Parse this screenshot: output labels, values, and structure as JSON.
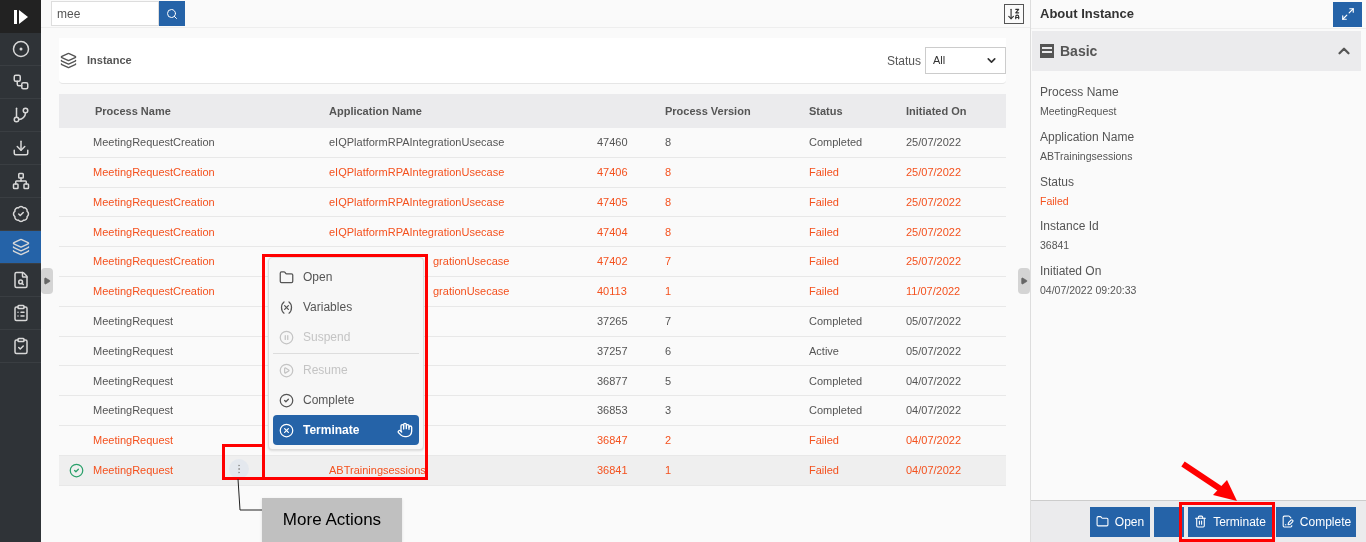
{
  "search": {
    "value": "mee"
  },
  "sidebar": {
    "items": [
      {
        "kind": "logo",
        "selected": false
      },
      {
        "kind": "circle-a",
        "selected": false
      },
      {
        "kind": "flow",
        "selected": false
      },
      {
        "kind": "branch",
        "selected": false
      },
      {
        "kind": "download",
        "selected": false
      },
      {
        "kind": "network",
        "selected": false
      },
      {
        "kind": "badge",
        "selected": false
      },
      {
        "kind": "instance",
        "selected": true
      },
      {
        "kind": "report",
        "selected": false
      },
      {
        "kind": "clipboard",
        "selected": false
      },
      {
        "kind": "task",
        "selected": false
      }
    ]
  },
  "instance_panel": {
    "title": "Instance",
    "status_filter": {
      "label": "Status",
      "value": "All"
    }
  },
  "table": {
    "columns": [
      "Process Name",
      "Application Name",
      "Process Version",
      "Status",
      "Initiated On"
    ],
    "rows": [
      {
        "process_name": "MeetingRequestCreation",
        "application_name": "eIQPlatformRPAIntegrationUsecase",
        "id": "47460",
        "version": "8",
        "status": "Completed",
        "initiated_on": "25/07/2022",
        "color": "#555555",
        "selected": false
      },
      {
        "process_name": "MeetingRequestCreation",
        "application_name": "eIQPlatformRPAIntegrationUsecase",
        "id": "47406",
        "version": "8",
        "status": "Failed",
        "initiated_on": "25/07/2022",
        "color": "#f4511e",
        "selected": false
      },
      {
        "process_name": "MeetingRequestCreation",
        "application_name": "eIQPlatformRPAIntegrationUsecase",
        "id": "47405",
        "version": "8",
        "status": "Failed",
        "initiated_on": "25/07/2022",
        "color": "#f4511e",
        "selected": false
      },
      {
        "process_name": "MeetingRequestCreation",
        "application_name": "eIQPlatformRPAIntegrationUsecase",
        "id": "47404",
        "version": "8",
        "status": "Failed",
        "initiated_on": "25/07/2022",
        "color": "#f4511e",
        "selected": false
      },
      {
        "process_name": "MeetingRequestCreation",
        "application_name": "grationUsecase",
        "id": "47402",
        "version": "7",
        "status": "Failed",
        "initiated_on": "25/07/2022",
        "color": "#f4511e",
        "selected": false
      },
      {
        "process_name": "MeetingRequestCreation",
        "application_name": "grationUsecase",
        "id": "40113",
        "version": "1",
        "status": "Failed",
        "initiated_on": "11/07/2022",
        "color": "#f4511e",
        "selected": false
      },
      {
        "process_name": "MeetingRequest",
        "id": "37265",
        "version": "7",
        "status": "Completed",
        "initiated_on": "05/07/2022",
        "color": "#555555",
        "selected": false
      },
      {
        "process_name": "MeetingRequest",
        "id": "37257",
        "version": "6",
        "status": "Active",
        "initiated_on": "05/07/2022",
        "color": "#555555",
        "selected": false
      },
      {
        "process_name": "MeetingRequest",
        "id": "36877",
        "version": "5",
        "status": "Completed",
        "initiated_on": "04/07/2022",
        "color": "#555555",
        "selected": false
      },
      {
        "process_name": "MeetingRequest",
        "id": "36853",
        "version": "3",
        "status": "Completed",
        "initiated_on": "04/07/2022",
        "color": "#555555",
        "selected": false
      },
      {
        "process_name": "MeetingRequest",
        "id": "36847",
        "version": "2",
        "status": "Failed",
        "initiated_on": "04/07/2022",
        "color": "#f4511e",
        "selected": false
      },
      {
        "process_name": "MeetingRequest",
        "application_name": "ABTrainingsessions",
        "id": "36841",
        "version": "1",
        "status": "Failed",
        "initiated_on": "04/07/2022",
        "color": "#f4511e",
        "selected": true
      }
    ]
  },
  "context_menu": {
    "items": [
      {
        "kind": "open",
        "label": "Open",
        "disabled": false,
        "selected": false
      },
      {
        "kind": "variables",
        "label": "Variables",
        "disabled": false,
        "selected": false
      },
      {
        "kind": "suspend",
        "label": "Suspend",
        "disabled": true,
        "selected": false
      },
      {
        "kind": "resume",
        "label": "Resume",
        "disabled": true,
        "selected": false
      },
      {
        "kind": "complete",
        "label": "Complete",
        "disabled": false,
        "selected": false
      },
      {
        "kind": "terminate",
        "label": "Terminate",
        "disabled": false,
        "selected": true
      }
    ]
  },
  "callout": "More Actions",
  "about": {
    "title": "About Instance",
    "section": {
      "title": "Basic",
      "expanded": true
    },
    "fields": [
      {
        "label": "Process Name",
        "value": "MeetingRequest",
        "color": "#555555"
      },
      {
        "label": "Application Name",
        "value": "ABTrainingsessions",
        "color": "#555555"
      },
      {
        "label": "Status",
        "value": "Failed",
        "color": "#f4511e"
      },
      {
        "label": "Instance Id",
        "value": "36841",
        "color": "#555555"
      },
      {
        "label": "Initiated On",
        "value": "04/07/2022 09:20:33",
        "color": "#555555"
      }
    ],
    "buttons": [
      {
        "kind": "open",
        "label": "Open"
      },
      {
        "kind": "blank"
      },
      {
        "kind": "terminate",
        "label": "Terminate"
      },
      {
        "kind": "complete",
        "label": "Complete"
      }
    ]
  }
}
